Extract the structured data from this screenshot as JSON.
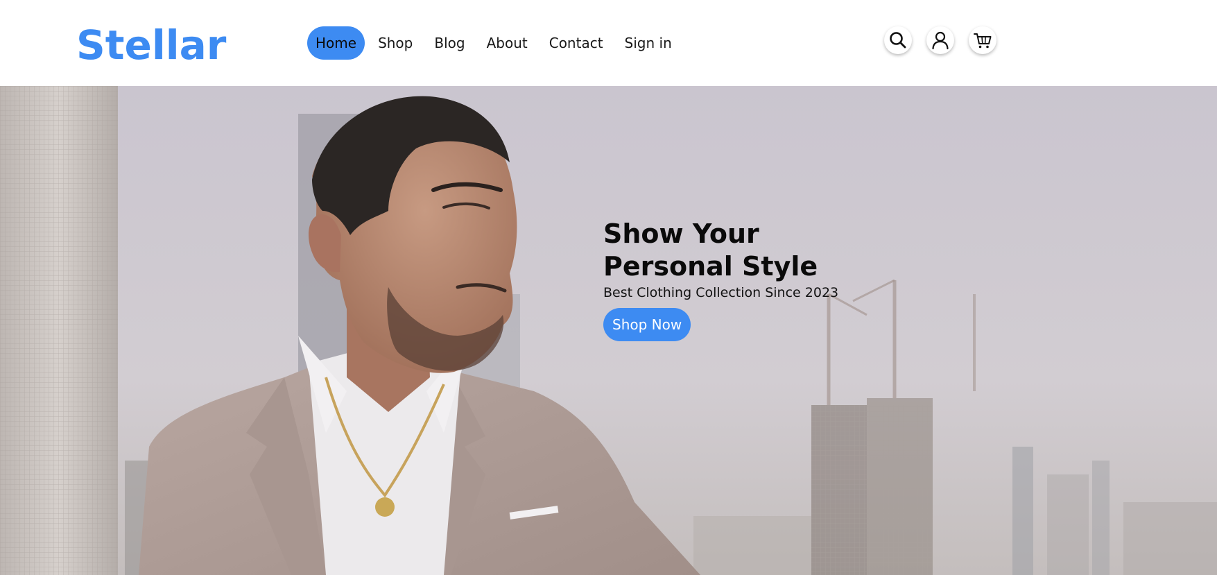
{
  "brand": {
    "name": "Stellar",
    "color": "#3d8bf2"
  },
  "nav": {
    "items": [
      {
        "label": "Home",
        "active": true
      },
      {
        "label": "Shop",
        "active": false
      },
      {
        "label": "Blog",
        "active": false
      },
      {
        "label": "About",
        "active": false
      },
      {
        "label": "Contact",
        "active": false
      },
      {
        "label": "Sign in",
        "active": false
      }
    ]
  },
  "header_icons": [
    "search-icon",
    "user-icon",
    "cart-icon"
  ],
  "hero": {
    "title_line1": "Show Your",
    "title_line2": "Personal Style",
    "subtitle": "Best Clothing Collection Since 2023",
    "cta_label": "Shop Now",
    "image": "man-in-beige-suit-city-skyline-photo"
  },
  "colors": {
    "accent": "#3d8bf2",
    "text": "#0a0a0a",
    "background": "#ffffff"
  }
}
